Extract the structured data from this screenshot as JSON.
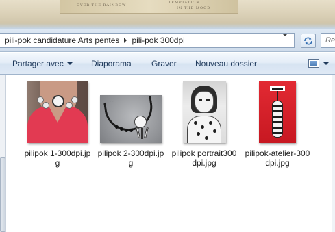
{
  "background": {
    "text_1": "OVER THE RAINBOW",
    "text_2": "TEMPTATION",
    "text_3": "IN THE MOOD"
  },
  "address_bar": {
    "breadcrumbs": [
      {
        "label": "pili-pok candidature Arts pentes"
      },
      {
        "label": "pili-pok 300dpi"
      }
    ],
    "search_placeholder": "Re"
  },
  "toolbar": {
    "share_label": "Partager avec",
    "slideshow_label": "Diaporama",
    "burn_label": "Graver",
    "new_folder_label": "Nouveau dossier"
  },
  "files": [
    {
      "name": "pilipok 1-300dpi.jpg",
      "thumb": "woman-pink-top-necklace"
    },
    {
      "name": "pilipok 2-300dpi.jpg",
      "thumb": "black-cord-necklace"
    },
    {
      "name": "pilipok portrait300dpi.jpg",
      "thumb": "sketch-portrait"
    },
    {
      "name": "pilipok-atelier-300dpi.jpg",
      "thumb": "red-card-pendant"
    }
  ],
  "colors": {
    "toolbar_text": "#1e395b",
    "selection_accent": "#3d78b5"
  }
}
